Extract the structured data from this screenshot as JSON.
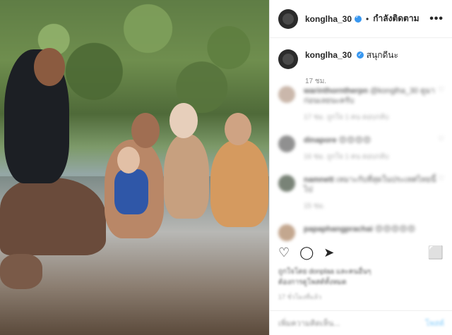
{
  "header": {
    "username": "konglha_30",
    "separator": "•",
    "follow_label": "กำลังติดตาม",
    "more_label": "•••"
  },
  "caption": {
    "username": "konglha_30",
    "text": "สนุกดีนะ",
    "time": "17 ชม."
  },
  "comments": [
    {
      "user": "warinthorntherpn",
      "text": "@konglha_30 ดูมาก่อนเลยนะครับ",
      "meta": "17 ชม.  ถูกใจ 1 คน  ตอบกลับ"
    },
    {
      "user": "dinapore",
      "text": "😍😍😍😍",
      "meta": "16 ชม.  ถูกใจ 1 คน  ตอบกลับ"
    },
    {
      "user": "namnett",
      "text": "เหมาะกับที่สุดในประเทศไทยนี้ไป",
      "meta": "15 ชม."
    },
    {
      "user": "papaphangprachai",
      "text": "😍😍😍😍😍",
      "meta": ""
    }
  ],
  "actions": {
    "like_icon": "♡",
    "comment_icon": "◯",
    "share_icon": "➤",
    "save_icon": "⬜"
  },
  "likes": {
    "line1": "ถูกใจโดย donplaa และคนอื่นๆ",
    "line2": "ต้องการดูโพสต์ทั้งหมด"
  },
  "posted": "17 ชั่วโมงที่แล้ว",
  "add_comment": {
    "placeholder": "เพิ่มความคิดเห็น...",
    "post_label": "โพสต์"
  }
}
